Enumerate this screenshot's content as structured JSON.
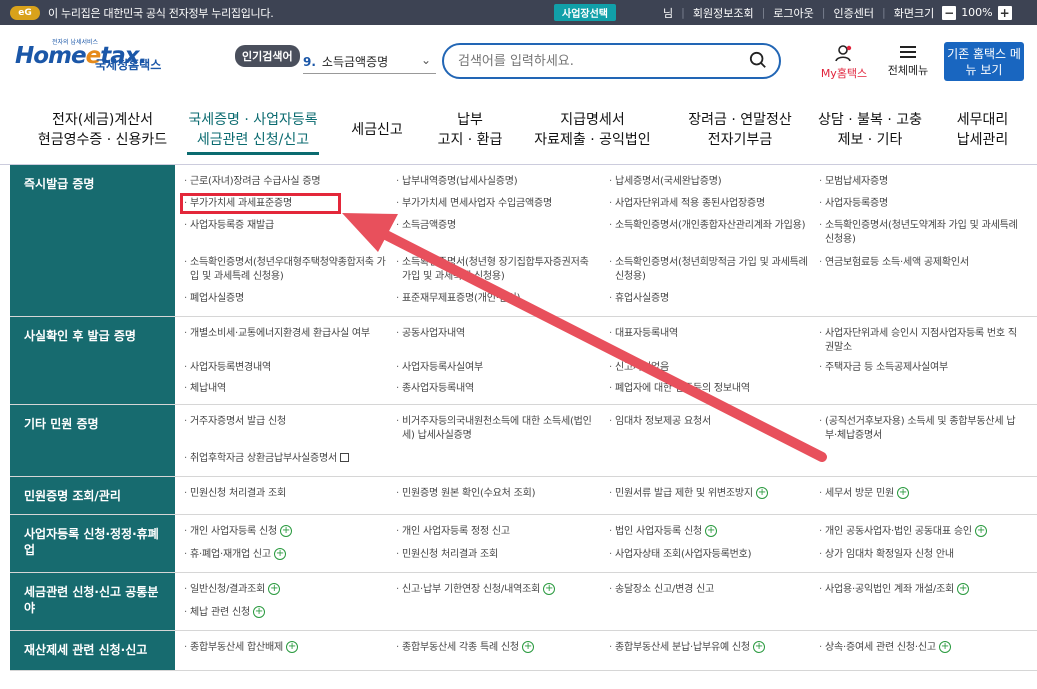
{
  "topbar": {
    "eg": "eG",
    "notice": "이 누리집은 대한민국 공식 전자정부 누리집입니다.",
    "business_select": "사업장선택",
    "links": [
      "님",
      "회원정보조회",
      "로그아웃",
      "인증센터",
      "화면크기"
    ],
    "zoom_minus": "−",
    "zoom_value": "100%",
    "zoom_plus": "+"
  },
  "header": {
    "logo_tag": "전자의 납세서비스",
    "logo_home": "Home",
    "logo_e": "e",
    "logo_tax": "tax.",
    "logo_nts": "국세청홈택스",
    "popular_label": "인기검색어",
    "popular_rank": "9.",
    "popular_term": "소득금액증명",
    "search_placeholder": "검색어를 입력하세요.",
    "my_hometax": "My홈택스",
    "all_menu": "전체메뉴",
    "old_hometax": "기존 홈택스 메뉴 보기"
  },
  "gnb": [
    {
      "line1": "전자(세금)계산서",
      "line2": "현금영수증 · 신용카드"
    },
    {
      "line1": "국세증명 · 사업자등록",
      "line2": "세금관련 신청/신고"
    },
    {
      "line1": "세금신고",
      "line2": ""
    },
    {
      "line1": "납부",
      "line2": "고지 · 환급"
    },
    {
      "line1": "지급명세서",
      "line2": "자료제출 · 공익법인"
    },
    {
      "line1": "장려금 · 연말정산",
      "line2": "전자기부금"
    },
    {
      "line1": "상담 · 불복 · 고충",
      "line2": "제보 · 기타"
    },
    {
      "line1": "세무대리",
      "line2": "납세관리"
    }
  ],
  "sections": [
    {
      "title": "즉시발급 증명",
      "items": [
        "근로(자녀)장려금 수급사실 증명",
        "납부내역증명(납세사실증명)",
        "납세증명서(국세완납증명)",
        "모범납세자증명",
        "부가가치세 과세표준증명",
        "부가가치세 면세사업자 수입금액증명",
        "사업자단위과세 적용 종된사업장증명",
        "사업자등록증명",
        "사업자등록증 재발급",
        "소득금액증명",
        "소득확인증명서(개인종합자산관리계좌 가입용)",
        "소득확인증명서(청년도약계좌 가입 및 과세특례 신청용)",
        "소득확인증명서(청년우대형주택청약종합저축 가입 및 과세특례 신청용)",
        "소득확인증명서(청년형 장기집합투자증권저축 가입 및 과세특례 신청용)",
        "소득확인증명서(청년희망적금 가입 및 과세특례 신청용)",
        "연금보험료등 소득·세액 공제확인서",
        "폐업사실증명",
        "표준재무제표증명(개인·법인)",
        "휴업사실증명",
        ""
      ]
    },
    {
      "title": "사실확인 후 발급 증명",
      "items": [
        "개별소비세·교통에너지환경세 환급사실 여부",
        "공동사업자내역",
        "대표자등록내역",
        "사업자단위과세 승인시 지점사업자등록 번호 직권말소",
        "사업자등록변경내역",
        "사업자등록사실여부",
        "신고사실없음",
        "주택자금 등 소득공제사실여부",
        "체납내역",
        "종사업자등록내역",
        "폐업자에 대한 업종등의 정보내역",
        ""
      ]
    },
    {
      "title": "기타 민원 증명",
      "items": [
        "거주자증명서 발급 신청",
        "비거주자등의국내원천소득에 대한 소득세(법인세) 납세사실증명",
        "임대차 정보제공 요청서",
        "(공직선거후보자용) 소득세 및 종합부동산세 납부·체납증명서",
        "취업후학자금 상환금납부사실증명서",
        "",
        "",
        ""
      ]
    },
    {
      "title": "민원증명 조회/관리",
      "items": [
        "민원신청 처리결과 조회",
        "민원증명 원본 확인(수요처 조회)",
        "민원서류 발급 제한 및 위변조방지",
        "세무서 방문 민원"
      ]
    },
    {
      "title": "사업자등록 신청·정정·휴폐업",
      "items": [
        "개인 사업자등록 신청",
        "개인 사업자등록 정정 신고",
        "법인 사업자등록 신청",
        "개인 공동사업자·법인 공동대표 승인",
        "휴·폐업·재개업 신고",
        "민원신청 처리결과 조회",
        "사업자상태 조회(사업자등록번호)",
        "상가 임대차 확정일자 신청 안내"
      ]
    },
    {
      "title": "세금관련 신청·신고 공통분야",
      "items": [
        "일반신청/결과조회",
        "신고·납부 기한연장 신청/내역조회",
        "송달장소 신고/변경 신고",
        "사업용·공익법인 계좌 개설/조회",
        "체납 관련 신청",
        "",
        "",
        ""
      ]
    },
    {
      "title": "재산제세 관련 신청·신고",
      "items": [
        "종합부동산세 합산배제",
        "종합부동산세 각종 특례 신청",
        "종합부동산세 분납·납부유예 신청",
        "상속·증여세 관련 신청·신고"
      ]
    }
  ],
  "colors": {
    "accent": "#176b6f",
    "highlight": "#e3273a",
    "brand": "#1b57a8"
  }
}
